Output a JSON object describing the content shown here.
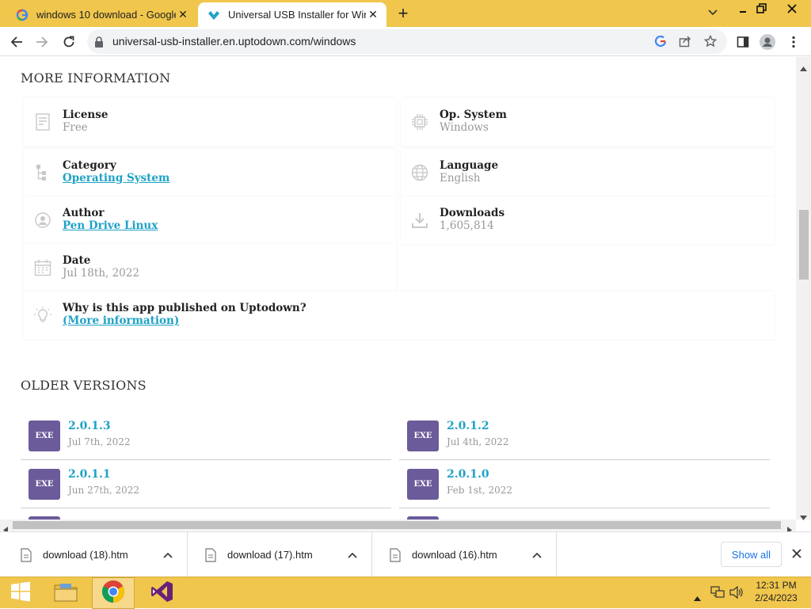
{
  "tabs": [
    {
      "title": "windows 10 download - Google S",
      "favicon": "google-g-icon",
      "active": false
    },
    {
      "title": "Universal USB Installer for Windo",
      "favicon": "uptodown-icon",
      "active": true
    }
  ],
  "toolbar": {
    "url": "universal-usb-installer.en.uptodown.com/windows"
  },
  "more_info": {
    "heading": "MORE INFORMATION",
    "license": {
      "title": "License",
      "value": "Free"
    },
    "os": {
      "title": "Op. System",
      "value": "Windows"
    },
    "category": {
      "title": "Category",
      "value": "Operating System"
    },
    "language": {
      "title": "Language",
      "value": "English"
    },
    "author": {
      "title": "Author",
      "value": "Pen Drive Linux"
    },
    "downloads": {
      "title": "Downloads",
      "value": "1,605,814"
    },
    "date": {
      "title": "Date",
      "value": "Jul 18th, 2022"
    },
    "why": {
      "title": "Why is this app published on Uptodown?",
      "link": "(More information)"
    }
  },
  "older_versions": {
    "heading": "OLDER VERSIONS",
    "badge": "EXE",
    "items": [
      {
        "version": "2.0.1.3",
        "date": "Jul 7th, 2022"
      },
      {
        "version": "2.0.1.2",
        "date": "Jul 4th, 2022"
      },
      {
        "version": "2.0.1.1",
        "date": "Jun 27th, 2022"
      },
      {
        "version": "2.0.1.0",
        "date": "Feb 1st, 2022"
      }
    ]
  },
  "downloads_shelf": {
    "items": [
      {
        "name": "download (18).htm"
      },
      {
        "name": "download (17).htm"
      },
      {
        "name": "download (16).htm"
      }
    ],
    "show_all": "Show all"
  },
  "taskbar": {
    "time": "12:31 PM",
    "date": "2/24/2023"
  },
  "colors": {
    "chrome_frame": "#f0c64c",
    "link": "#1fa2c5",
    "exe_badge": "#6b5b9a"
  }
}
